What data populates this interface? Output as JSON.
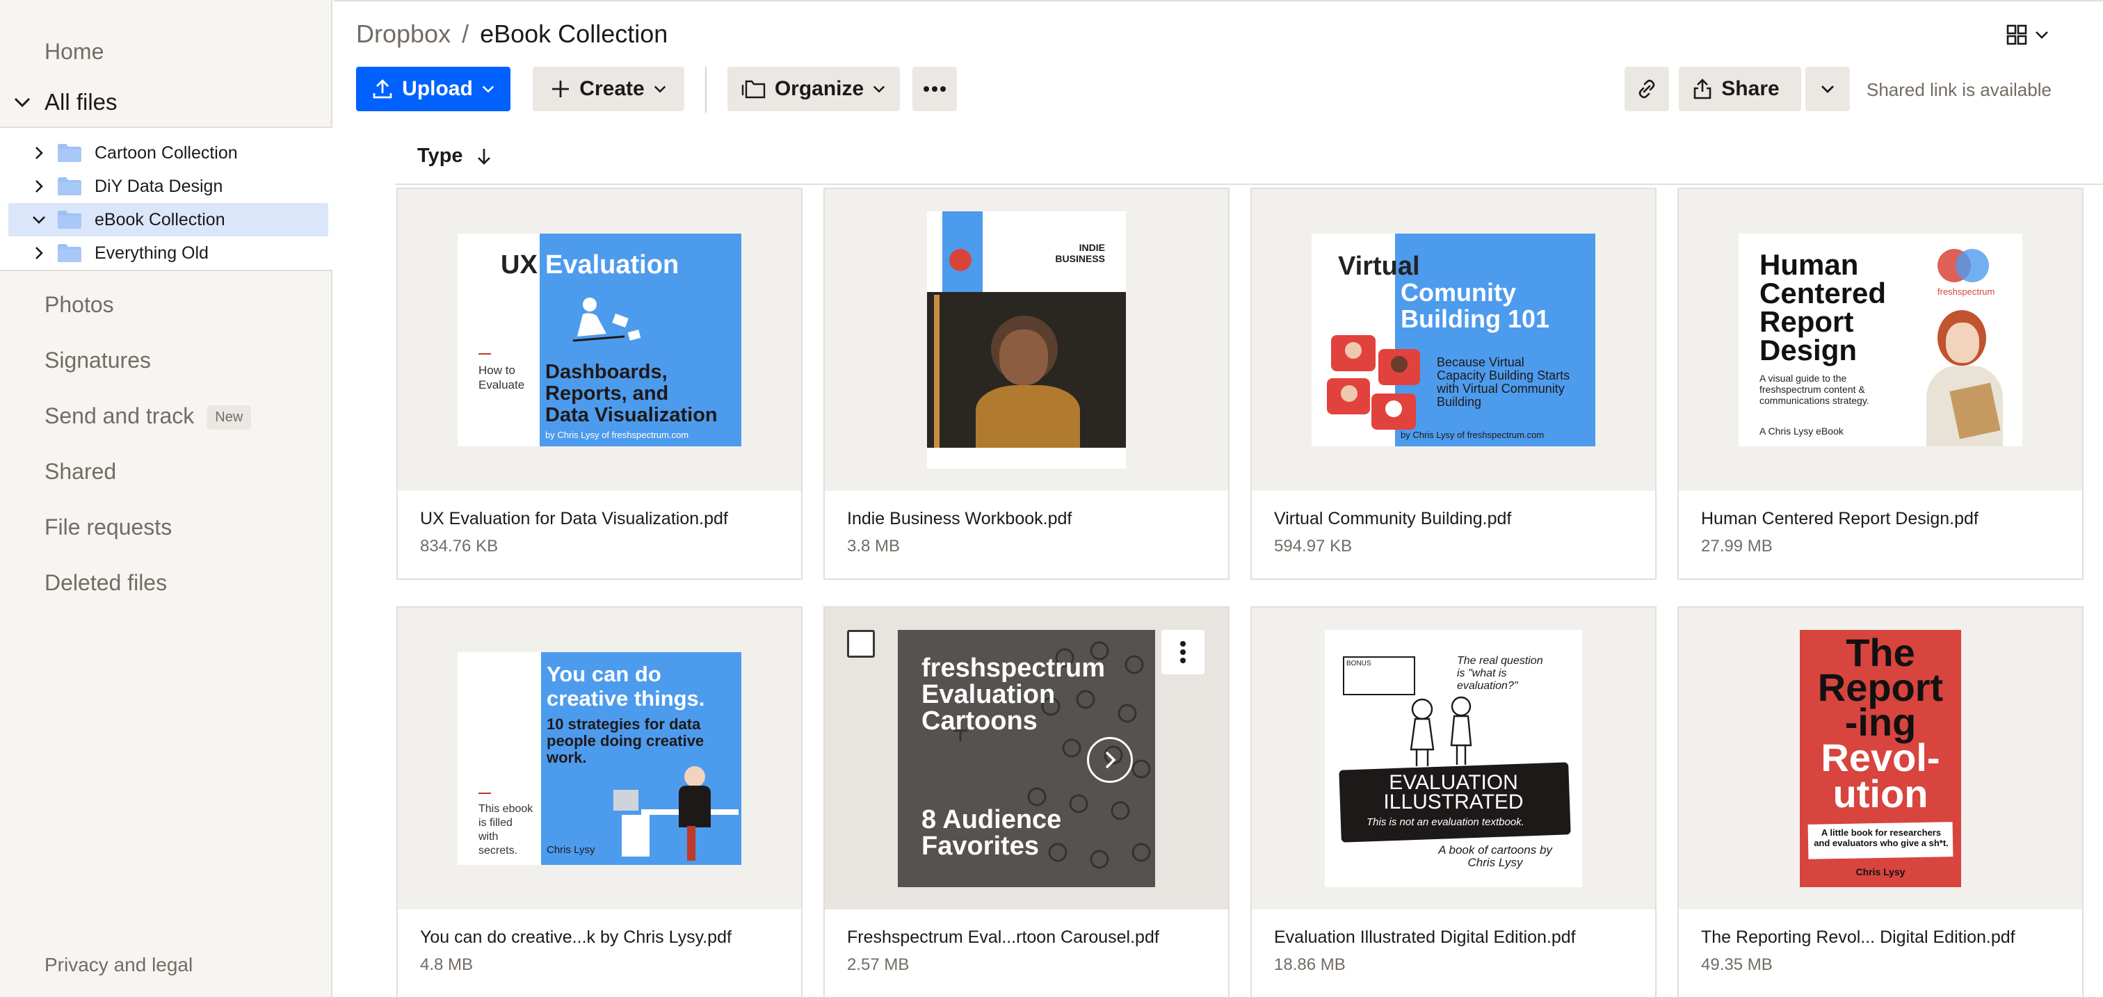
{
  "sidebar": {
    "home": "Home",
    "all_files": "All files",
    "tree": [
      {
        "label": "Cartoon Collection"
      },
      {
        "label": "DiY Data Design"
      },
      {
        "label": "eBook Collection"
      },
      {
        "label": "Everything Old"
      }
    ],
    "photos": "Photos",
    "signatures": "Signatures",
    "send_and_track": "Send and track",
    "new_badge": "New",
    "shared": "Shared",
    "file_requests": "File requests",
    "deleted_files": "Deleted files",
    "privacy": "Privacy and legal"
  },
  "breadcrumb": {
    "root": "Dropbox",
    "separator": "/",
    "current": "eBook Collection"
  },
  "toolbar": {
    "upload": "Upload",
    "create": "Create",
    "organize": "Organize",
    "share": "Share",
    "shared_link_status": "Shared link is available"
  },
  "sort": {
    "label": "Type"
  },
  "colors": {
    "accent": "#0061fe",
    "sidebar_bg": "#f7f5f2",
    "cover_blue": "#4d9bed"
  },
  "files": [
    {
      "name": "UX Evaluation for Data Visualization.pdf",
      "size": "834.76 KB",
      "cover": {
        "t1": "UX",
        "t2": "Evaluation",
        "t3": "Dashboards,",
        "t4": "Reports, and",
        "t5": "Data Visualization",
        "side": "How to Evaluate",
        "by": "by Chris Lysy of freshspectrum.com"
      }
    },
    {
      "name": "Indie Business Workbook.pdf",
      "size": "3.8 MB",
      "cover": {
        "t1": "INDIE",
        "t2": "BUSINESS"
      }
    },
    {
      "name": "Virtual Community Building.pdf",
      "size": "594.97 KB",
      "cover": {
        "t1": "Virtual",
        "t2": "Comunity",
        "t3": "Building 101",
        "t4": "Because Virtual Capacity Building Starts with Virtual Community Building",
        "by": "by Chris Lysy of freshspectrum.com"
      }
    },
    {
      "name": "Human Centered Report Design.pdf",
      "size": "27.99 MB",
      "cover": {
        "t1": "Human",
        "t2": "Centered",
        "t3": "Report",
        "t4": "Design",
        "sub": "A visual guide to the freshspectrum content & communications strategy.",
        "by": "A Chris Lysy eBook",
        "brand": "freshspectrum"
      }
    },
    {
      "name": "You can do creative...k by Chris Lysy.pdf",
      "size": "4.8 MB",
      "cover": {
        "t1": "You can do creative things.",
        "t2": "10 strategies for data people doing creative work.",
        "side": "This ebook is filled with secrets.",
        "by": "Chris Lysy"
      }
    },
    {
      "name": "Freshspectrum Eval...rtoon Carousel.pdf",
      "size": "2.57 MB",
      "cover": {
        "t1": "freshspectrum",
        "t2": "Evaluation",
        "t3": "Cartoons",
        "t4": "8 Audience",
        "t5": "Favorites"
      }
    },
    {
      "name": "Evaluation Illustrated Digital Edition.pdf",
      "size": "18.86 MB",
      "cover": {
        "t1": "EVALUATION",
        "t2": "ILLUSTRATED",
        "t3": "This is not an evaluation textbook.",
        "t4": "A book of cartoons by Chris Lysy",
        "bonus": "BONUS",
        "quote": "The real question is \"what is evaluation?\""
      }
    },
    {
      "name": "The Reporting Revol... Digital Edition.pdf",
      "size": "49.35 MB",
      "cover": {
        "t1": "The",
        "t2": "Report",
        "t3": "-ing",
        "t4": "Revol-",
        "t5": "ution",
        "sub": "A little book for researchers and evaluators who give a sh*t.",
        "by": "Chris Lysy"
      }
    }
  ]
}
